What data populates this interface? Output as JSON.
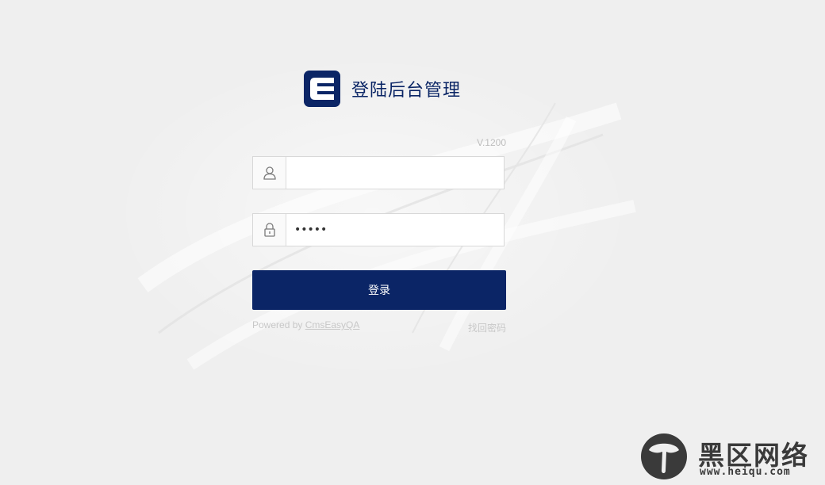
{
  "header": {
    "title": "登陆后台管理",
    "logo_icon": "cmseasy-logo-icon",
    "brand_color": "#0b2566"
  },
  "version": "V.1200",
  "form": {
    "username": {
      "icon": "user-icon",
      "value": "",
      "placeholder": ""
    },
    "password": {
      "icon": "lock-icon",
      "value": "•••••"
    },
    "submit_label": "登录"
  },
  "footer": {
    "powered_prefix": "Powered by ",
    "powered_link": "CmsEasyQA",
    "forgot_label": "找回密码"
  },
  "watermark": {
    "title": "黑区网络",
    "url": "www.heiqu.com"
  }
}
